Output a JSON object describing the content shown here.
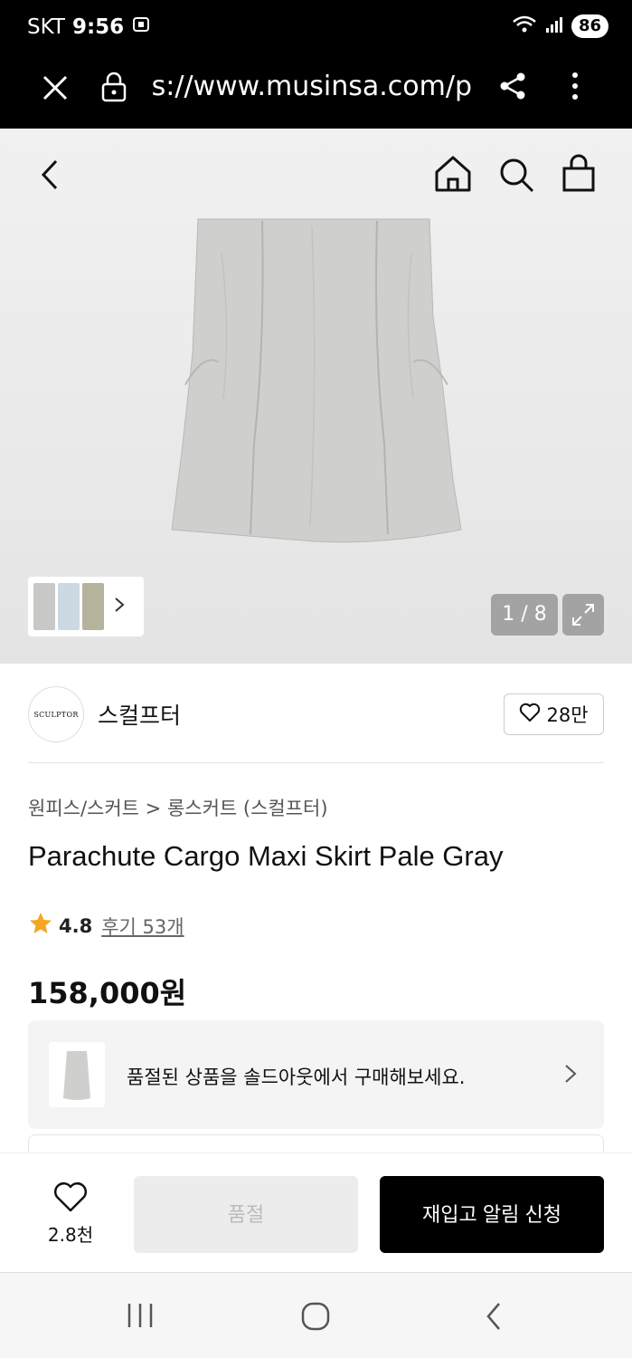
{
  "status_bar": {
    "carrier": "SKT",
    "time": "9:56",
    "battery": "86",
    "icons": [
      "screenshot-icon",
      "wifi-icon",
      "signal-icon"
    ]
  },
  "browser": {
    "url": "https://www.musinsa.com/p",
    "icons": [
      "close-icon",
      "lock-icon",
      "share-icon",
      "more-icon"
    ]
  },
  "hero": {
    "icons": [
      "back-icon",
      "home-icon",
      "search-icon",
      "cart-icon",
      "chevron-right-icon",
      "expand-icon"
    ],
    "page_indicator": "1 / 8"
  },
  "brand": {
    "logo_text": "SCULPTOR",
    "name": "스컬프터",
    "likes": "28만"
  },
  "product": {
    "breadcrumb": "원피스/스커트 > 롱스커트 (스컬프터)",
    "title": "Parachute Cargo Maxi Skirt Pale Gray",
    "rating": "4.8",
    "reviews": "후기 53개",
    "price": "158,000원"
  },
  "soldout_banner": {
    "text": "품절된 상품을 솔드아웃에서 구매해보세요."
  },
  "actions": {
    "wish_count": "2.8천",
    "soldout_label": "품절",
    "restock_label": "재입고 알림 신청"
  },
  "colors": {
    "accent_star": "#f5a623",
    "primary_button": "#000000",
    "disabled_button": "#ececec"
  }
}
